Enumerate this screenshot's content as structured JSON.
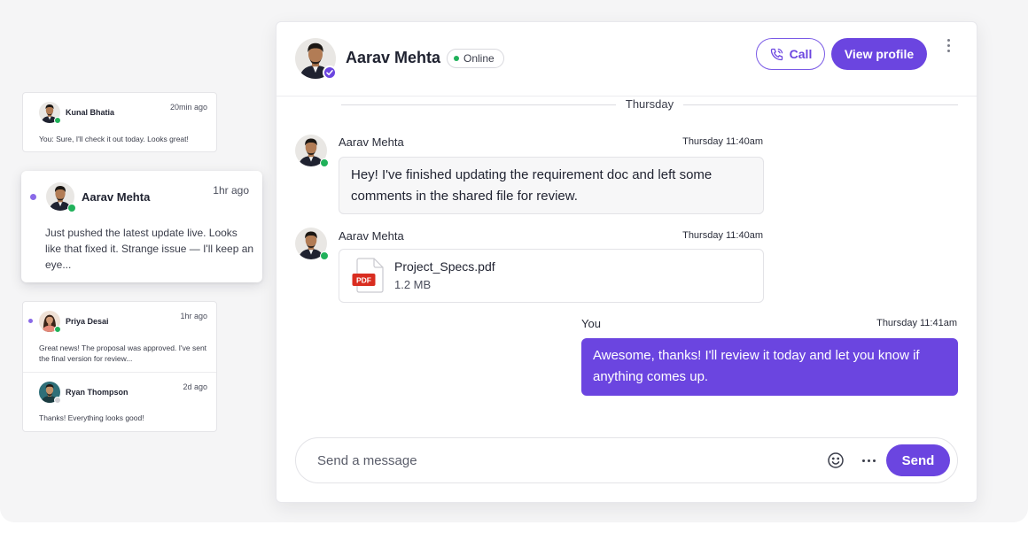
{
  "conversations": [
    {
      "name": "Kunal Bhatia",
      "time": "20min ago",
      "preview": "You: Sure, I'll check it out today. Looks great!",
      "status_color": "#20b15a"
    },
    {
      "name": "Aarav Mehta",
      "time": "1hr ago",
      "preview": "Just pushed the latest update live. Looks like that fixed it. Strange issue — I'll keep an eye...",
      "unread": true,
      "status_color": "#20b15a"
    },
    {
      "name": "Priya Desai",
      "time": "1hr ago",
      "preview": "Great news! The proposal was approved. I've sent the final version for review...",
      "unread": true,
      "status_color": "#20b15a"
    },
    {
      "name": "Ryan Thompson",
      "time": "2d ago",
      "preview": "Thanks! Everything looks good!",
      "status_color": "#d0d0d5"
    }
  ],
  "header": {
    "name": "Aarav Mehta",
    "status": "Online",
    "call_label": "Call",
    "profile_label": "View profile"
  },
  "day_separator": "Thursday",
  "messages": [
    {
      "sender": "Aarav Mehta",
      "time": "Thursday 11:40am",
      "text": "Hey! I've finished updating the requirement doc and left some comments in the shared file for review."
    },
    {
      "sender": "Aarav Mehta",
      "time": "Thursday 11:40am",
      "attachment": {
        "type_label": "PDF",
        "name": "Project_Specs.pdf",
        "size": "1.2 MB"
      }
    },
    {
      "sender": "You",
      "time": "Thursday 11:41am",
      "text": "Awesome, thanks! I'll review it today and let you know if anything comes up."
    }
  ],
  "composer": {
    "placeholder": "Send a message",
    "send_label": "Send"
  },
  "colors": {
    "accent": "#6b45e0",
    "online": "#20b15a",
    "unread_dot": "#8a6ae8"
  },
  "icons": [
    "phone-icon",
    "kebab-menu-icon",
    "verified-icon",
    "pdf-file-icon",
    "emoji-icon",
    "more-horizontal-icon"
  ]
}
